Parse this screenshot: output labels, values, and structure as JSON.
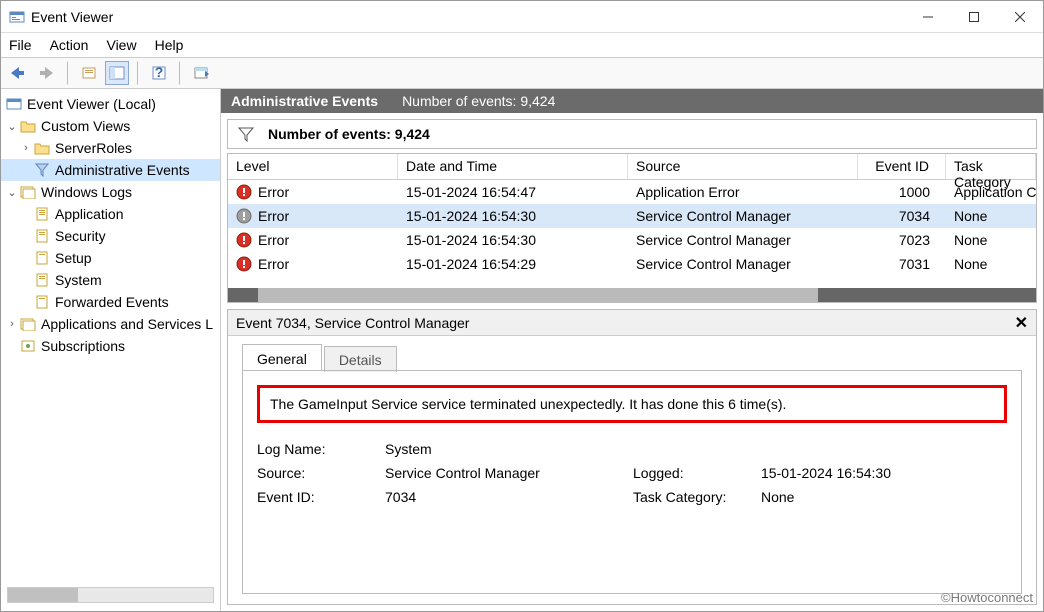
{
  "window": {
    "title": "Event Viewer"
  },
  "menus": {
    "file": "File",
    "action": "Action",
    "view": "View",
    "help": "Help"
  },
  "tree": {
    "root": "Event Viewer (Local)",
    "custom_views": "Custom Views",
    "server_roles": "ServerRoles",
    "admin_events": "Administrative Events",
    "windows_logs": "Windows Logs",
    "application": "Application",
    "security": "Security",
    "setup": "Setup",
    "system": "System",
    "forwarded": "Forwarded Events",
    "apps_services": "Applications and Services L",
    "subscriptions": "Subscriptions"
  },
  "caption": {
    "title": "Administrative Events",
    "count_label": "Number of events: 9,424"
  },
  "filter": {
    "count_label": "Number of events: 9,424"
  },
  "columns": {
    "level": "Level",
    "dt": "Date and Time",
    "src": "Source",
    "eid": "Event ID",
    "tc": "Task Category"
  },
  "rows": [
    {
      "level": "Error",
      "dt": "15-01-2024 16:54:47",
      "src": "Application Error",
      "eid": "1000",
      "tc": "Application C"
    },
    {
      "level": "Error",
      "dt": "15-01-2024 16:54:30",
      "src": "Service Control Manager",
      "eid": "7034",
      "tc": "None"
    },
    {
      "level": "Error",
      "dt": "15-01-2024 16:54:30",
      "src": "Service Control Manager",
      "eid": "7023",
      "tc": "None"
    },
    {
      "level": "Error",
      "dt": "15-01-2024 16:54:29",
      "src": "Service Control Manager",
      "eid": "7031",
      "tc": "None"
    }
  ],
  "details": {
    "header": "Event 7034, Service Control Manager",
    "tabs": {
      "general": "General",
      "details": "Details"
    },
    "message": "The GameInput Service service terminated unexpectedly.  It has done this 6 time(s).",
    "labels": {
      "log_name": "Log Name:",
      "source": "Source:",
      "event_id": "Event ID:",
      "logged": "Logged:",
      "task_cat": "Task Category:"
    },
    "values": {
      "log_name": "System",
      "source": "Service Control Manager",
      "event_id": "7034",
      "logged": "15-01-2024 16:54:30",
      "task_cat": "None"
    }
  },
  "watermark": "©Howtoconnect"
}
